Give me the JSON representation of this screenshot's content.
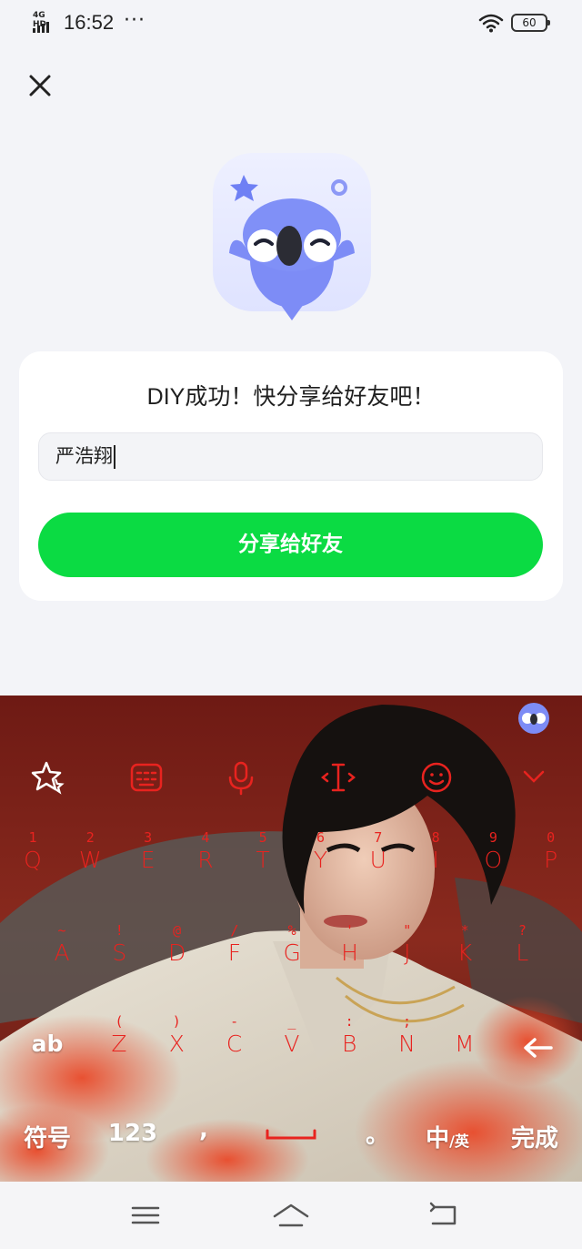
{
  "status_bar": {
    "network": "4G HD",
    "time": "16:52",
    "more": "···",
    "battery": "60"
  },
  "card": {
    "title": "DIY成功！快分享给好友吧！",
    "input_value": "严浩翔",
    "share_button": "分享给好友"
  },
  "keyboard": {
    "row1": [
      {
        "hint": "1",
        "key": "Q"
      },
      {
        "hint": "2",
        "key": "W"
      },
      {
        "hint": "3",
        "key": "E"
      },
      {
        "hint": "4",
        "key": "R"
      },
      {
        "hint": "5",
        "key": "T"
      },
      {
        "hint": "6",
        "key": "Y"
      },
      {
        "hint": "7",
        "key": "U"
      },
      {
        "hint": "8",
        "key": "I"
      },
      {
        "hint": "9",
        "key": "O"
      },
      {
        "hint": "0",
        "key": "P"
      }
    ],
    "row2": [
      {
        "hint": "~",
        "key": "A"
      },
      {
        "hint": "!",
        "key": "S"
      },
      {
        "hint": "@",
        "key": "D"
      },
      {
        "hint": "/",
        "key": "F"
      },
      {
        "hint": "%",
        "key": "G"
      },
      {
        "hint": "'",
        "key": "H"
      },
      {
        "hint": "\"",
        "key": "J"
      },
      {
        "hint": "*",
        "key": "K"
      },
      {
        "hint": "?",
        "key": "L"
      }
    ],
    "row3": [
      {
        "hint": "(",
        "key": "Z"
      },
      {
        "hint": ")",
        "key": "X"
      },
      {
        "hint": "-",
        "key": "C"
      },
      {
        "hint": "_",
        "key": "V"
      },
      {
        "hint": ":",
        "key": "B"
      },
      {
        "hint": ";",
        "key": "N"
      },
      {
        "hint": "",
        "key": "M"
      }
    ],
    "shift_label": "ab",
    "symbols_label": "符号",
    "numbers_label": "123",
    "comma_label": ",",
    "period_label": "。",
    "lang_label_main": "中",
    "lang_label_sub": "/英",
    "done_label": "完成",
    "key_color": "#e8231f"
  },
  "icons": [
    "close-icon",
    "mascot-icon",
    "star-icon",
    "keyboard-icon",
    "microphone-icon",
    "text-cursor-icon",
    "emoji-icon",
    "chevron-down-icon",
    "backspace-icon",
    "space-icon",
    "menu-icon",
    "home-icon",
    "back-icon",
    "wifi-icon",
    "signal-icon",
    "battery-icon"
  ],
  "colors": {
    "page_bg": "#f3f4f8",
    "accent_green": "#0bdb43",
    "mascot_blue": "#6f80f4"
  }
}
